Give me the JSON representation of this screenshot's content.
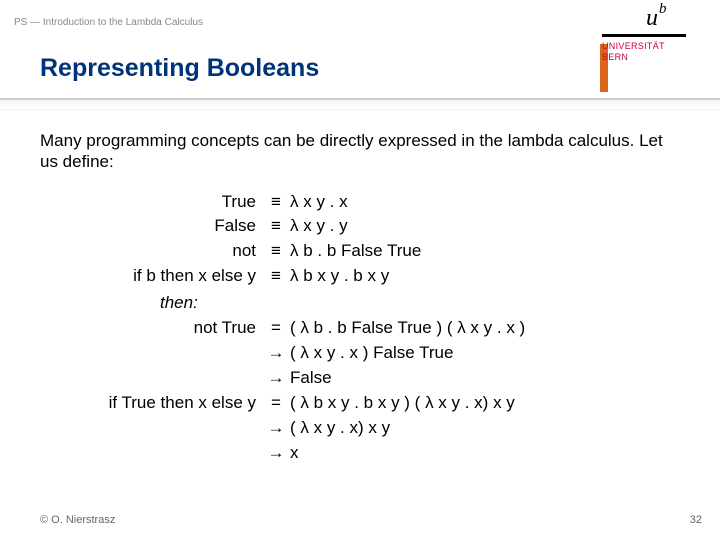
{
  "header": {
    "breadcrumb": "PS — Introduction to the Lambda Calculus",
    "title": "Representing Booleans"
  },
  "logo": {
    "mark_u": "u",
    "mark_b": "b",
    "line1": "UNIVERSITÄT",
    "line2": "BERN"
  },
  "intro": "Many programming concepts can be directly expressed in the lambda calculus. Let us define:",
  "rows": [
    {
      "lhs": "True",
      "op": "≡",
      "rhs": "λ x y . x"
    },
    {
      "lhs": "False",
      "op": "≡",
      "rhs": "λ x y . y"
    },
    {
      "lhs": "not",
      "op": "≡",
      "rhs": "λ b . b False True"
    },
    {
      "lhs": "if b then x else y",
      "op": "≡",
      "rhs": "λ b x y . b x y"
    }
  ],
  "then_label": "then:",
  "derivations": [
    {
      "lhs": "not True",
      "op": "=",
      "rhs": "( λ b . b False True ) ( λ x y . x )"
    },
    {
      "lhs": "",
      "op": "→",
      "rhs": "( λ x y . x ) False True"
    },
    {
      "lhs": "",
      "op": "→",
      "rhs": "False"
    },
    {
      "lhs": "if True then x else y",
      "op": "=",
      "rhs": "( λ b x y . b x y ) ( λ x y . x) x y"
    },
    {
      "lhs": "",
      "op": "→",
      "rhs": "( λ x y . x) x y"
    },
    {
      "lhs": "",
      "op": "→",
      "rhs": "x"
    }
  ],
  "footer": {
    "copyright": "© O. Nierstrasz",
    "page": "32"
  }
}
